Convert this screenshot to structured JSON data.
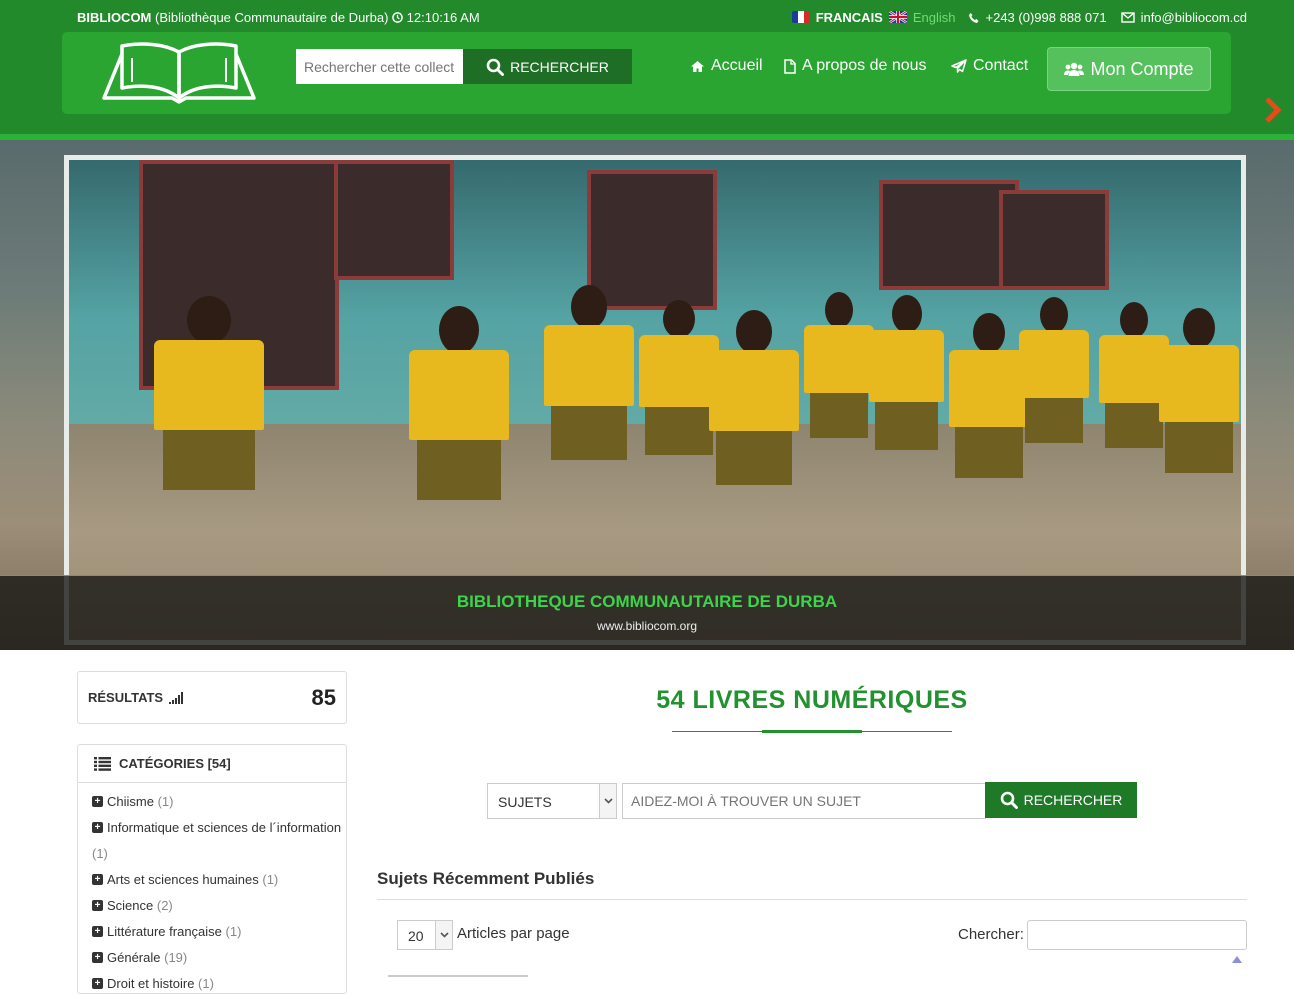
{
  "topbar": {
    "site_name": "BIBLIOCOM",
    "site_full": "(Bibliothèque Communautaire de Durba)",
    "time": "12:10:16 AM",
    "lang_fr": "FRANCAIS",
    "lang_en": "English",
    "phone": "+243 (0)998 888 071",
    "email": "info@bibliocom.cd"
  },
  "header": {
    "search_placeholder": "Rechercher cette collect",
    "search_button": "RECHERCHER",
    "nav": {
      "home": "Accueil",
      "about": "A propos de nous",
      "contact": "Contact"
    },
    "account_button": "Mon Compte"
  },
  "banner": {
    "title": "BIBLIOTHEQUE COMMUNAUTAIRE DE DURBA",
    "subtitle": "www.bibliocom.org"
  },
  "sidebar": {
    "results_label": "RÉSULTATS",
    "results_count": "85",
    "categories_title": "CATÉGORIES [54]",
    "categories": [
      {
        "label": "Chiisme",
        "count": "(1)"
      },
      {
        "label": "Informatique et sciences de l´information",
        "count": "(1)"
      },
      {
        "label": "Arts et sciences humaines",
        "count": "(1)"
      },
      {
        "label": "Science",
        "count": "(2)"
      },
      {
        "label": "Littérature française",
        "count": "(1)"
      },
      {
        "label": "Générale",
        "count": "(19)"
      },
      {
        "label": "Droit et histoire",
        "count": "(1)"
      }
    ]
  },
  "main": {
    "title": "54 LIVRES NUMÉRIQUES",
    "filter_select": "SUJETS",
    "filter_placeholder": "AIDEZ-MOI À TROUVER UN SUJET",
    "filter_button": "RECHERCHER",
    "section_title": "Sujets Récemment Publiés",
    "per_page_value": "20",
    "per_page_label": "Articles par page",
    "search_label": "Chercher:"
  },
  "colors": {
    "header_green": "#238a2c",
    "nav_green": "#2aa532",
    "title_green": "#239130",
    "button_dark_green": "#1f7a28",
    "account_button": "#55c15d"
  },
  "icons": [
    "clock-icon",
    "phone-icon",
    "envelope-icon",
    "search-icon",
    "home-icon",
    "file-icon",
    "send-icon",
    "users-icon",
    "chevron-right-icon",
    "signal-icon",
    "list-icon",
    "plus-square-icon",
    "caret-down-icon",
    "sort-up-icon"
  ]
}
